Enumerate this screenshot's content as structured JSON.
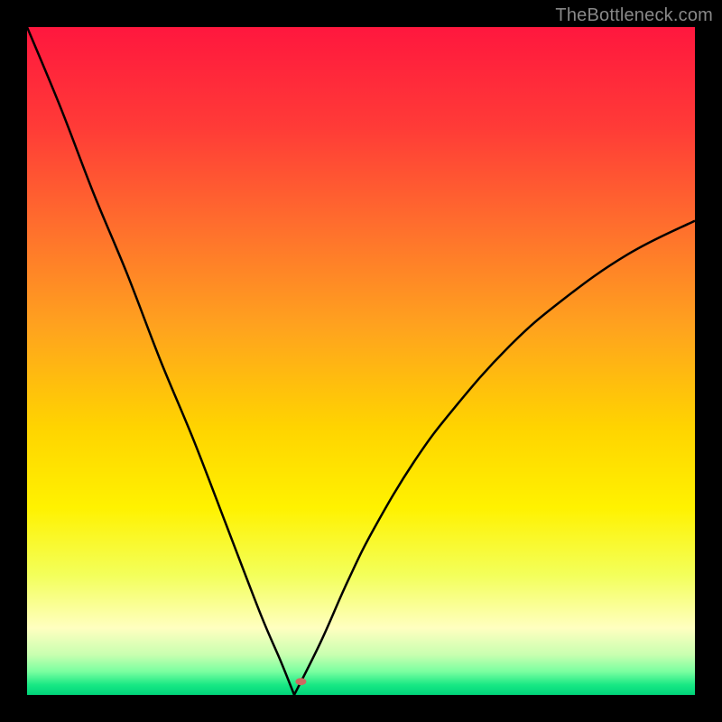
{
  "watermark": "TheBottleneck.com",
  "chart_data": {
    "type": "line",
    "title": "",
    "xlabel": "",
    "ylabel": "",
    "ylim": [
      0,
      100
    ],
    "xlim": [
      0,
      100
    ],
    "curve_min_x": 40,
    "marker": {
      "x": 41,
      "y": 2,
      "color": "#cd6a61",
      "rx": 6,
      "ry": 4
    },
    "series": [
      {
        "name": "bottleneck-curve-left",
        "x": [
          0,
          5,
          10,
          15,
          20,
          25,
          30,
          35,
          38,
          40
        ],
        "y": [
          100,
          88,
          75,
          63,
          50,
          38,
          25,
          12,
          5,
          0
        ]
      },
      {
        "name": "bottleneck-curve-right",
        "x": [
          40,
          44,
          48,
          52,
          58,
          64,
          72,
          80,
          90,
          100
        ],
        "y": [
          0,
          8,
          17,
          25,
          35,
          43,
          52,
          59,
          66,
          71
        ]
      }
    ],
    "gradient_stops": [
      {
        "offset": 0.0,
        "color": "#ff173e"
      },
      {
        "offset": 0.15,
        "color": "#ff3b37"
      },
      {
        "offset": 0.3,
        "color": "#ff6f2d"
      },
      {
        "offset": 0.45,
        "color": "#ffa31e"
      },
      {
        "offset": 0.6,
        "color": "#ffd400"
      },
      {
        "offset": 0.72,
        "color": "#fff200"
      },
      {
        "offset": 0.82,
        "color": "#f3ff5a"
      },
      {
        "offset": 0.9,
        "color": "#ffffc0"
      },
      {
        "offset": 0.94,
        "color": "#c8ffb0"
      },
      {
        "offset": 0.965,
        "color": "#7affa0"
      },
      {
        "offset": 0.985,
        "color": "#18e884"
      },
      {
        "offset": 1.0,
        "color": "#00d47a"
      }
    ]
  }
}
